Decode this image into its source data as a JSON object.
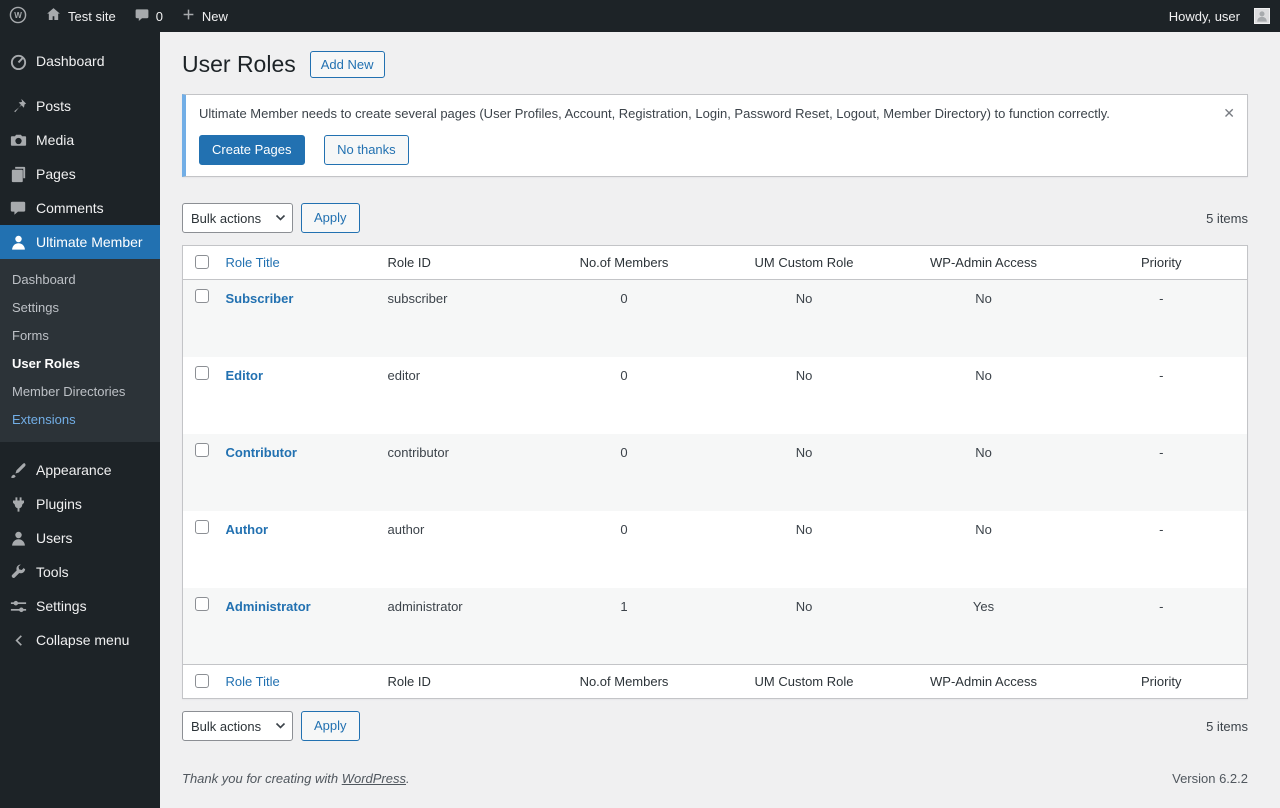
{
  "colors": {
    "accent": "#2271b1",
    "admin_bar_bg": "#1d2327",
    "submenu_bg": "#2c3338",
    "notice_accent": "#72aee6",
    "row_stripe": "#f6f7f7"
  },
  "icons": {
    "close": "✕"
  },
  "admin_bar": {
    "site_name": "Test site",
    "comments_count": "0",
    "new_label": "New",
    "howdy": "Howdy, user"
  },
  "sidebar": {
    "items": [
      {
        "label": "Dashboard"
      },
      {
        "label": "Posts"
      },
      {
        "label": "Media"
      },
      {
        "label": "Pages"
      },
      {
        "label": "Comments"
      },
      {
        "label": "Ultimate Member"
      },
      {
        "label": "Appearance"
      },
      {
        "label": "Plugins"
      },
      {
        "label": "Users"
      },
      {
        "label": "Tools"
      },
      {
        "label": "Settings"
      },
      {
        "label": "Collapse menu"
      }
    ],
    "um_submenu": [
      {
        "label": "Dashboard"
      },
      {
        "label": "Settings"
      },
      {
        "label": "Forms"
      },
      {
        "label": "User Roles"
      },
      {
        "label": "Member Directories"
      },
      {
        "label": "Extensions"
      }
    ]
  },
  "page": {
    "title": "User Roles",
    "add_new_label": "Add New"
  },
  "notice": {
    "text": "Ultimate Member needs to create several pages (User Profiles, Account, Registration, Login, Password Reset, Logout, Member Directory) to function correctly.",
    "create_pages_label": "Create Pages",
    "no_thanks_label": "No thanks"
  },
  "toolbar": {
    "bulk_actions_label": "Bulk actions",
    "apply_label": "Apply",
    "items_count": "5 items"
  },
  "table": {
    "headers": [
      "Role Title",
      "Role ID",
      "No.of Members",
      "UM Custom Role",
      "WP-Admin Access",
      "Priority"
    ],
    "rows": [
      {
        "title": "Subscriber",
        "role_id": "subscriber",
        "members": "0",
        "um_custom_role": "No",
        "wp_admin_access": "No",
        "priority": "-"
      },
      {
        "title": "Editor",
        "role_id": "editor",
        "members": "0",
        "um_custom_role": "No",
        "wp_admin_access": "No",
        "priority": "-"
      },
      {
        "title": "Contributor",
        "role_id": "contributor",
        "members": "0",
        "um_custom_role": "No",
        "wp_admin_access": "No",
        "priority": "-"
      },
      {
        "title": "Author",
        "role_id": "author",
        "members": "0",
        "um_custom_role": "No",
        "wp_admin_access": "No",
        "priority": "-"
      },
      {
        "title": "Administrator",
        "role_id": "administrator",
        "members": "1",
        "um_custom_role": "No",
        "wp_admin_access": "Yes",
        "priority": "-"
      }
    ]
  },
  "footer": {
    "thank_you_prefix": "Thank you for creating with ",
    "wordpress_link_label": "WordPress",
    "suffix": ".",
    "version": "Version 6.2.2"
  }
}
